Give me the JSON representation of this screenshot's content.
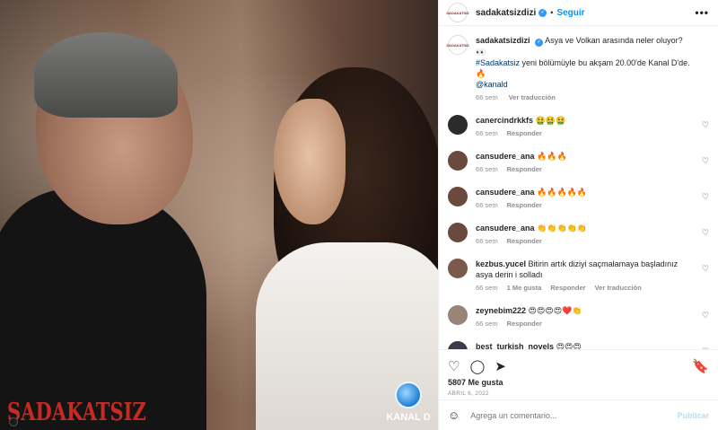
{
  "media": {
    "show_logo": "SADAKATSIZ",
    "channel_name": "KANAL D"
  },
  "header": {
    "username": "sadakatsizdizi",
    "verified_mark": "✓",
    "separator": "•",
    "follow_label": "Seguir",
    "more_label": "•••",
    "avatar_text": "SADAKATSIZ"
  },
  "caption": {
    "username": "sadakatsizdizi",
    "text_1": "Asya ve Volkan arasında neler oluyor? 👀",
    "hashtag": "#Sadakatsiz",
    "text_2": " yeni bölümüyle bu akşam 20.00'de Kanal D'de. 🔥",
    "mention": "@kanald",
    "time": "66 sem",
    "translate": "Ver traducción"
  },
  "comments": [
    {
      "username": "canercindrkkfs",
      "text": "🤮🤮🤮",
      "time": "66 sem",
      "likes": "",
      "reply": "Responder",
      "translate": "",
      "avatar_color": "#2b2b2b"
    },
    {
      "username": "cansudere_ana",
      "text": "🔥🔥🔥",
      "time": "66 sem",
      "likes": "",
      "reply": "Responder",
      "translate": "",
      "avatar_color": "#6b4a3e"
    },
    {
      "username": "cansudere_ana",
      "text": "🔥🔥🔥🔥🔥",
      "time": "66 sem",
      "likes": "",
      "reply": "Responder",
      "translate": "",
      "avatar_color": "#6b4a3e"
    },
    {
      "username": "cansudere_ana",
      "text": "👏👏👏👏👏",
      "time": "66 sem",
      "likes": "",
      "reply": "Responder",
      "translate": "",
      "avatar_color": "#6b4a3e"
    },
    {
      "username": "kezbus.yucel",
      "text": "Bitirin artık diziyi saçmalamaya başladınız asya derin i solladı",
      "time": "66 sem",
      "likes": "1 Me gusta",
      "reply": "Responder",
      "translate": "Ver traducción",
      "avatar_color": "#7a5a4a"
    },
    {
      "username": "zeynebim222",
      "text": "😍😍😍😍❤️👏",
      "time": "66 sem",
      "likes": "",
      "reply": "Responder",
      "translate": "",
      "avatar_color": "#9a8478"
    },
    {
      "username": "best_turkish_novels",
      "text": "😍😍😍",
      "time": "66 sem",
      "likes": "",
      "reply": "Responder",
      "translate": "",
      "avatar_color": "#3b3b4b"
    }
  ],
  "actions": {
    "like_icon": "♡",
    "comment_icon": "◯",
    "share_icon": "➤",
    "save_icon": "🔖",
    "likes_text": "5807 Me gusta",
    "date": "ABRIL 6, 2022"
  },
  "comment_bar": {
    "emoji_icon": "☺",
    "placeholder": "Agrega un comentario...",
    "post_label": "Publicar"
  }
}
